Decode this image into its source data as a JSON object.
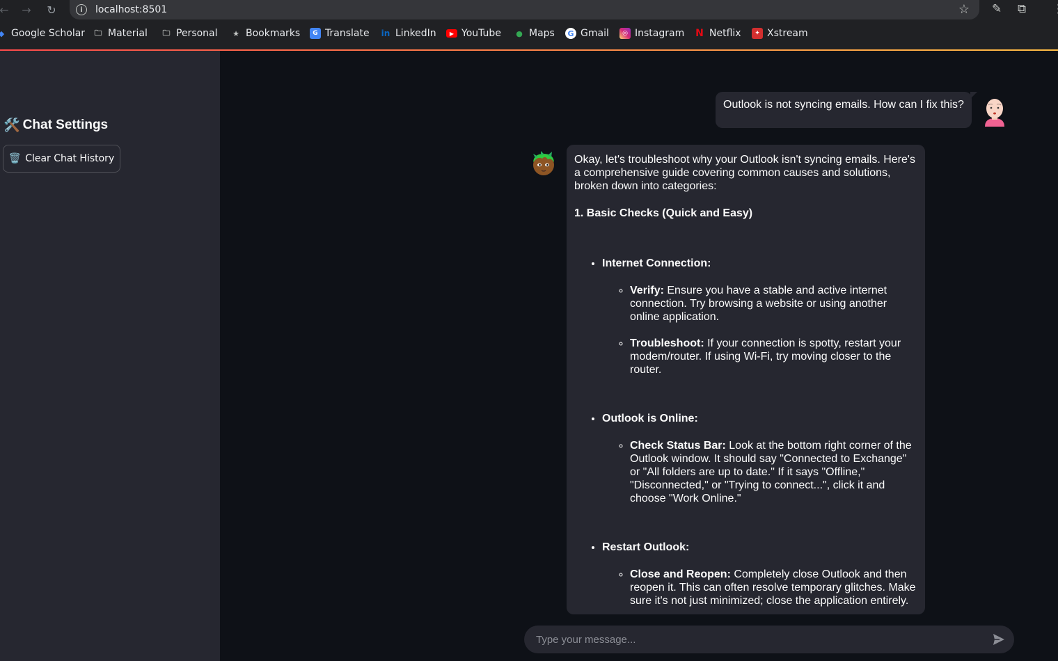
{
  "browser": {
    "url": "localhost:8501",
    "nav_back_icon": "arrow-left-icon",
    "nav_forward_icon": "arrow-right-icon",
    "reload_icon": "reload-icon"
  },
  "bookmarks": [
    {
      "label": "Google Scholar",
      "icon": "scholar-icon",
      "color": "#4285f4"
    },
    {
      "label": "Material",
      "icon": "folder-icon",
      "color": "#c4c7c5"
    },
    {
      "label": "Personal",
      "icon": "folder-icon",
      "color": "#c4c7c5"
    },
    {
      "label": "Bookmarks",
      "icon": "star-icon",
      "color": "#c4c7c5"
    },
    {
      "label": "Translate",
      "icon": "translate-icon",
      "color": "#4285f4"
    },
    {
      "label": "LinkedIn",
      "icon": "linkedin-icon",
      "color": "#0a66c2"
    },
    {
      "label": "YouTube",
      "icon": "youtube-icon",
      "color": "#ff0000"
    },
    {
      "label": "Maps",
      "icon": "maps-icon",
      "color": "#34a853"
    },
    {
      "label": "Gmail",
      "icon": "google-icon",
      "color": "#ea4335"
    },
    {
      "label": "Instagram",
      "icon": "instagram-icon",
      "color": "#e1306c"
    },
    {
      "label": "Netflix",
      "icon": "netflix-icon",
      "color": "#e50914"
    },
    {
      "label": "Xstream",
      "icon": "xstream-icon",
      "color": "#d32f2f"
    }
  ],
  "sidebar": {
    "title_emoji": "🛠️",
    "title": "Chat Settings",
    "clear_button_emoji": "🗑️",
    "clear_button_label": "Clear Chat History"
  },
  "chat": {
    "user_message": "Outlook is not syncing emails. How can I fix this?",
    "bot_intro": "Okay, let's troubleshoot why your Outlook isn't syncing emails. Here's a comprehensive guide covering common causes and solutions, broken down into categories:",
    "section_heading": "1. Basic Checks (Quick and Easy)",
    "items": [
      {
        "title": "Internet Connection:",
        "subitems": [
          {
            "label": "Verify:",
            "text": " Ensure you have a stable and active internet connection. Try browsing a website or using another online application."
          },
          {
            "label": "Troubleshoot:",
            "text": " If your connection is spotty, restart your modem/router. If using Wi-Fi, try moving closer to the router."
          }
        ]
      },
      {
        "title": "Outlook is Online:",
        "subitems": [
          {
            "label": "Check Status Bar:",
            "text": " Look at the bottom right corner of the Outlook window. It should say \"Connected to Exchange\" or \"All folders are up to date.\" If it says \"Offline,\" \"Disconnected,\" or \"Trying to connect...\", click it and choose \"Work Online.\""
          }
        ]
      },
      {
        "title": "Restart Outlook:",
        "subitems": [
          {
            "label": "Close and Reopen:",
            "text": " Completely close Outlook and then reopen it. This can often resolve temporary glitches. Make sure it's not just minimized; close the application entirely."
          }
        ]
      }
    ],
    "input_placeholder": "Type your message...",
    "colors": {
      "background": "#0e1117",
      "sidebar": "#262730",
      "bubble": "#262730",
      "text": "#fafafa"
    }
  }
}
